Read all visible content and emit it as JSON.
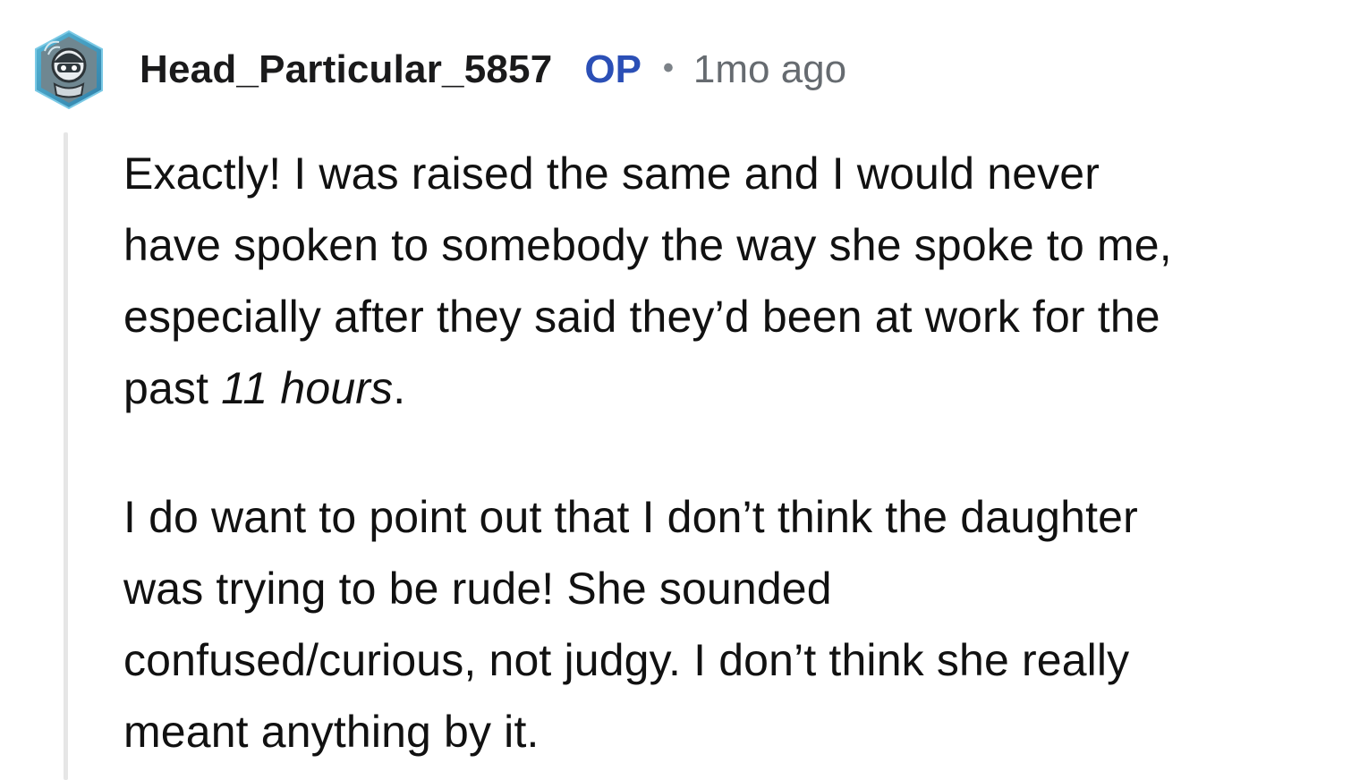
{
  "comment": {
    "username": "Head_Particular_5857",
    "badge": "OP",
    "separator": "•",
    "timestamp": "1mo ago",
    "avatar": {
      "icon": "robot-avatar-icon",
      "accent": "#3aa2c8"
    },
    "paragraphs": [
      {
        "lines": [
          "Exactly! I was raised the same and I would never",
          "have spoken to somebody the way she spoke to me,",
          "especially after they said they’d been at work for the"
        ],
        "tail_prefix": "past ",
        "tail_emphasis": "11 hours",
        "tail_suffix": "."
      },
      {
        "lines": [
          "I do want to point out that I don’t think the daughter",
          "was trying to be rude! She sounded",
          "confused/curious, not judgy. I don’t think she really",
          "meant anything by it."
        ]
      }
    ]
  },
  "colors": {
    "text": "#111111",
    "op": "#2b4fb6",
    "meta": "#666b70",
    "thread_line": "#e6e6e6"
  }
}
